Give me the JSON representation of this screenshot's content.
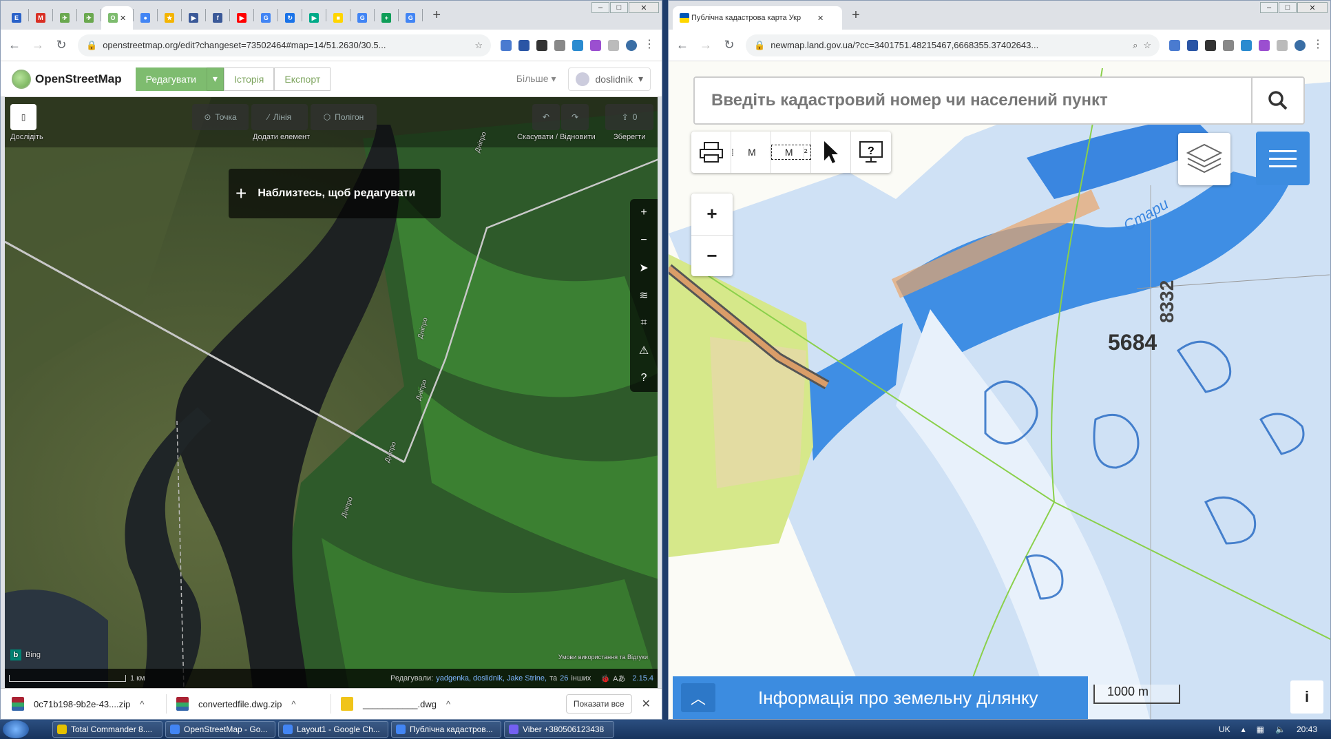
{
  "left_window": {
    "tabs": [
      {
        "label": "E",
        "color": "#2a62c9"
      },
      {
        "label": "M",
        "color": "#d93025"
      },
      {
        "label": "✈",
        "color": "#6aa84f"
      },
      {
        "label": "✈",
        "color": "#6aa84f"
      },
      {
        "label": "O",
        "color": "#7ebc6f",
        "active": true
      },
      {
        "label": "●",
        "color": "#4285f4"
      },
      {
        "label": "★",
        "color": "#f4b400"
      },
      {
        "label": "▶",
        "color": "#3b5998"
      },
      {
        "label": "f",
        "color": "#3b5998"
      },
      {
        "label": "▶",
        "color": "#ff0000"
      },
      {
        "label": "G",
        "color": "#4285f4"
      },
      {
        "label": "↻",
        "color": "#1a73e8"
      },
      {
        "label": "▶",
        "color": "#0a8"
      },
      {
        "label": "■",
        "color": "#ffd500"
      },
      {
        "label": "G",
        "color": "#4285f4"
      },
      {
        "label": "+",
        "color": "#0f9d58"
      },
      {
        "label": "G",
        "color": "#4285f4"
      }
    ],
    "url": "openstreetmap.org/edit?changeset=73502464#map=14/51.2630/30.5...",
    "osm": {
      "logo_text": "OpenStreetMap",
      "edit_label": "Редагувати",
      "history_label": "Історія",
      "export_label": "Експорт",
      "more_label": "Більше",
      "username": "doslidnik"
    },
    "id_editor": {
      "explore_label": "Дослідіть",
      "point_label": "Точка",
      "line_label": "Лінія",
      "polygon_label": "Полігон",
      "add_feature_label": "Додати елемент",
      "undo_redo_label": "Скасувати / Відновити",
      "save_label": "Зберегти",
      "save_count": "0",
      "zoom_banner": "Наблизтесь, щоб редагувати",
      "river_labels": [
        "Дніпро",
        "Дніпро",
        "Дніпро",
        "Дніпро",
        "Дніпро"
      ],
      "imagery_label": "Bing",
      "terms_label": "Умови використання та Відгуки",
      "scale_label": "1 км",
      "editors_prefix": "Редагували:",
      "editors": "yadgenka, doslidnik, Jake Strine,",
      "editors_suffix": "та",
      "editors_count": "26",
      "editors_others": "інших",
      "version": "2.15.4"
    },
    "downloads": [
      {
        "name": "0c71b198-9b2e-43....zip"
      },
      {
        "name": "convertedfile.dwg.zip"
      },
      {
        "name": "___________.dwg"
      }
    ],
    "show_all_label": "Показати все"
  },
  "right_window": {
    "tab_title": "Публічна кадастрова карта Укр",
    "url": "newmap.land.gov.ua/?cc=3401751.48215467,6668355.37402643...",
    "search_placeholder": "Введіть кадастровий номер чи населений пункт",
    "tool_labels": {
      "measure": "M",
      "area": "M"
    },
    "zoom_in": "+",
    "zoom_out": "−",
    "info_label": "Інформація про земельну ділянку",
    "scale_label": "1000 m",
    "info_btn": "i",
    "map_labels": [
      "5684",
      "8332",
      "Стари"
    ]
  },
  "taskbar": {
    "items": [
      {
        "label": "Total Commander 8....",
        "color": "#e4c100"
      },
      {
        "label": "OpenStreetMap - Go...",
        "color": "#4285f4"
      },
      {
        "label": "Layout1 - Google Ch...",
        "color": "#4285f4"
      },
      {
        "label": "Публічна кадастров...",
        "color": "#4285f4"
      },
      {
        "label": "Viber +380506123438",
        "color": "#7360f2"
      }
    ],
    "lang": "UK",
    "time": "20:43"
  }
}
